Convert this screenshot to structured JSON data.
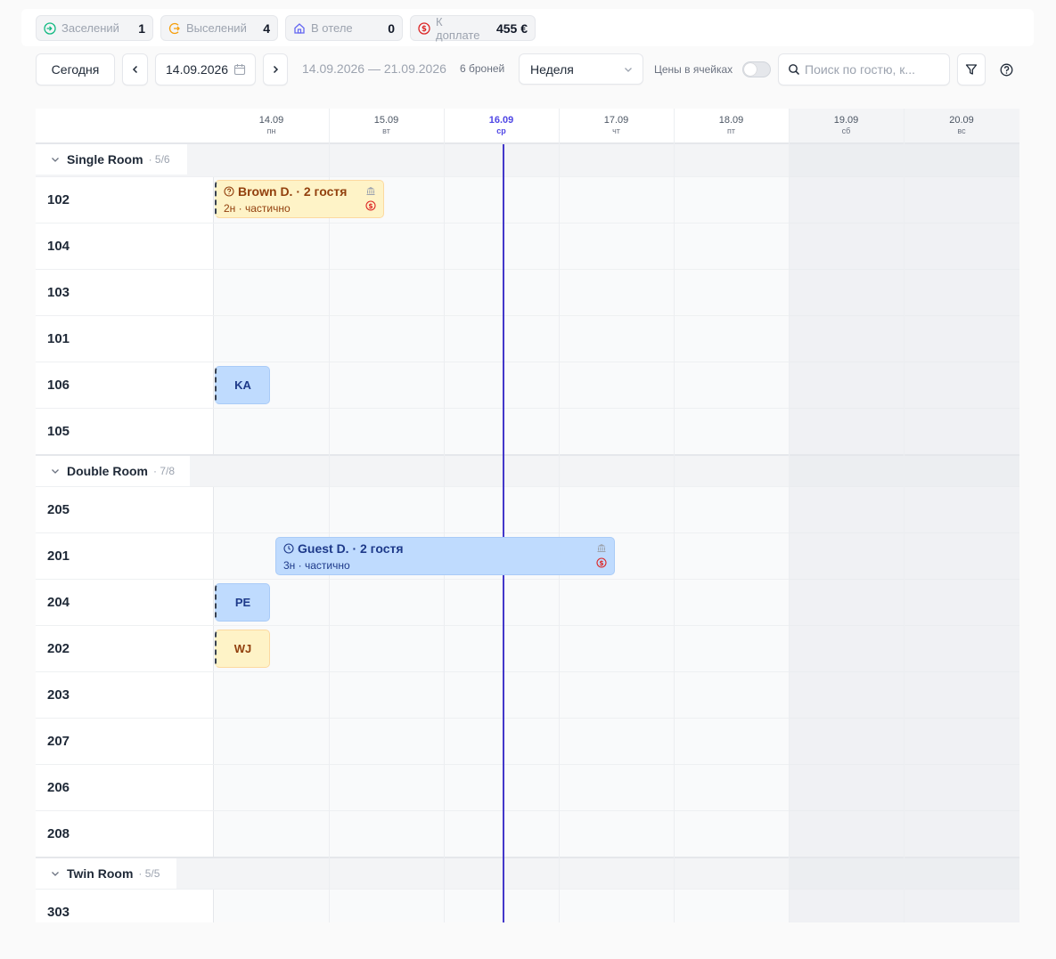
{
  "stats": [
    {
      "label": "Заселений",
      "value": "1",
      "icon": "check-in-icon",
      "color": "#10b981"
    },
    {
      "label": "Выселений",
      "value": "4",
      "icon": "check-out-icon",
      "color": "#f59e0b"
    },
    {
      "label": "В отеле",
      "value": "0",
      "icon": "hotel-icon",
      "color": "#6366f1"
    },
    {
      "label": "К доплате",
      "value": "455 €",
      "icon": "dollar-icon",
      "color": "#dc2626"
    }
  ],
  "toolbar": {
    "today_label": "Сегодня",
    "date_value": "14.09.2026",
    "range_text": "14.09.2026 — 21.09.2026",
    "bookings_count": "6 броней",
    "view_select": "Неделя",
    "prices_label": "Цены в ячейках",
    "search_placeholder": "Поиск по гостю, к..."
  },
  "days": [
    {
      "date": "14.09",
      "weekday": "пн"
    },
    {
      "date": "15.09",
      "weekday": "вт"
    },
    {
      "date": "16.09",
      "weekday": "ср"
    },
    {
      "date": "17.09",
      "weekday": "чт"
    },
    {
      "date": "18.09",
      "weekday": "пт"
    },
    {
      "date": "19.09",
      "weekday": "сб"
    },
    {
      "date": "20.09",
      "weekday": "вс"
    }
  ],
  "groups": [
    {
      "name": "Single Room",
      "count": "· 5/6"
    },
    {
      "name": "Double Room",
      "count": "· 7/8"
    },
    {
      "name": "Twin Room",
      "count": "· 5/5"
    }
  ],
  "rooms": [
    "102",
    "104",
    "103",
    "101",
    "106",
    "105",
    "205",
    "201",
    "204",
    "202",
    "203",
    "207",
    "206",
    "208",
    "303"
  ],
  "bookings": {
    "brown": {
      "title": "Brown D. · 2 гостя",
      "sub": "2н · частично",
      "status_icon": "question-icon"
    },
    "guest": {
      "title": "Guest D. · 2 гостя",
      "sub": "3н · частично",
      "status_icon": "clock-icon"
    },
    "ka": {
      "initials": "KA"
    },
    "pe": {
      "initials": "PE"
    },
    "wj": {
      "initials": "WJ"
    }
  },
  "colors": {
    "today": "#4338ca",
    "booking_yellow": "#fef3c7",
    "booking_blue": "#bfdbfe"
  }
}
